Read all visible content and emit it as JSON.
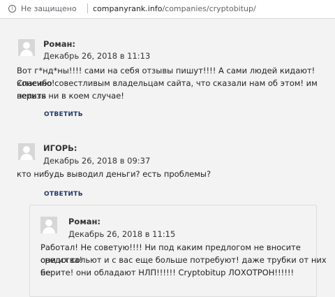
{
  "browser": {
    "security": "Не защищено",
    "url_domain": "companyrank.info",
    "url_path": "/companies/cryptobitup/"
  },
  "comments": [
    {
      "author": "Роман:",
      "date": "Декабрь 26, 2018 в 11:13",
      "lines": [
        "Вот г*нд*ны!!!! сами на себя отзывы пишут!!!! А сами людей кидают! конечно!",
        "Спасибо совестливым владельцам сайта, что сказали нам об этом! им верить",
        "нельзя ни в коем случае!"
      ],
      "reply": "ОТВЕТИТЬ"
    },
    {
      "author": "ИГОРЬ:",
      "date": "Декабрь 26, 2018 в 09:37",
      "lines": [
        "кто нибудь выводил деньги? есть проблемы?"
      ],
      "reply": "ОТВЕТИТЬ"
    },
    {
      "author": "Роман:",
      "date": "Декабрь 26, 2018 в 11:15",
      "lines": [
        "Работал! Не советую!!!! Ни под каким предлогом не вносите средства!",
        "они их сольют и с вас еще больше потребуют! даже трубки от них не",
        "берите! они обладают НЛП!!!!!! Cryptobitup ЛОХОТРОН!!!!!!"
      ]
    }
  ]
}
